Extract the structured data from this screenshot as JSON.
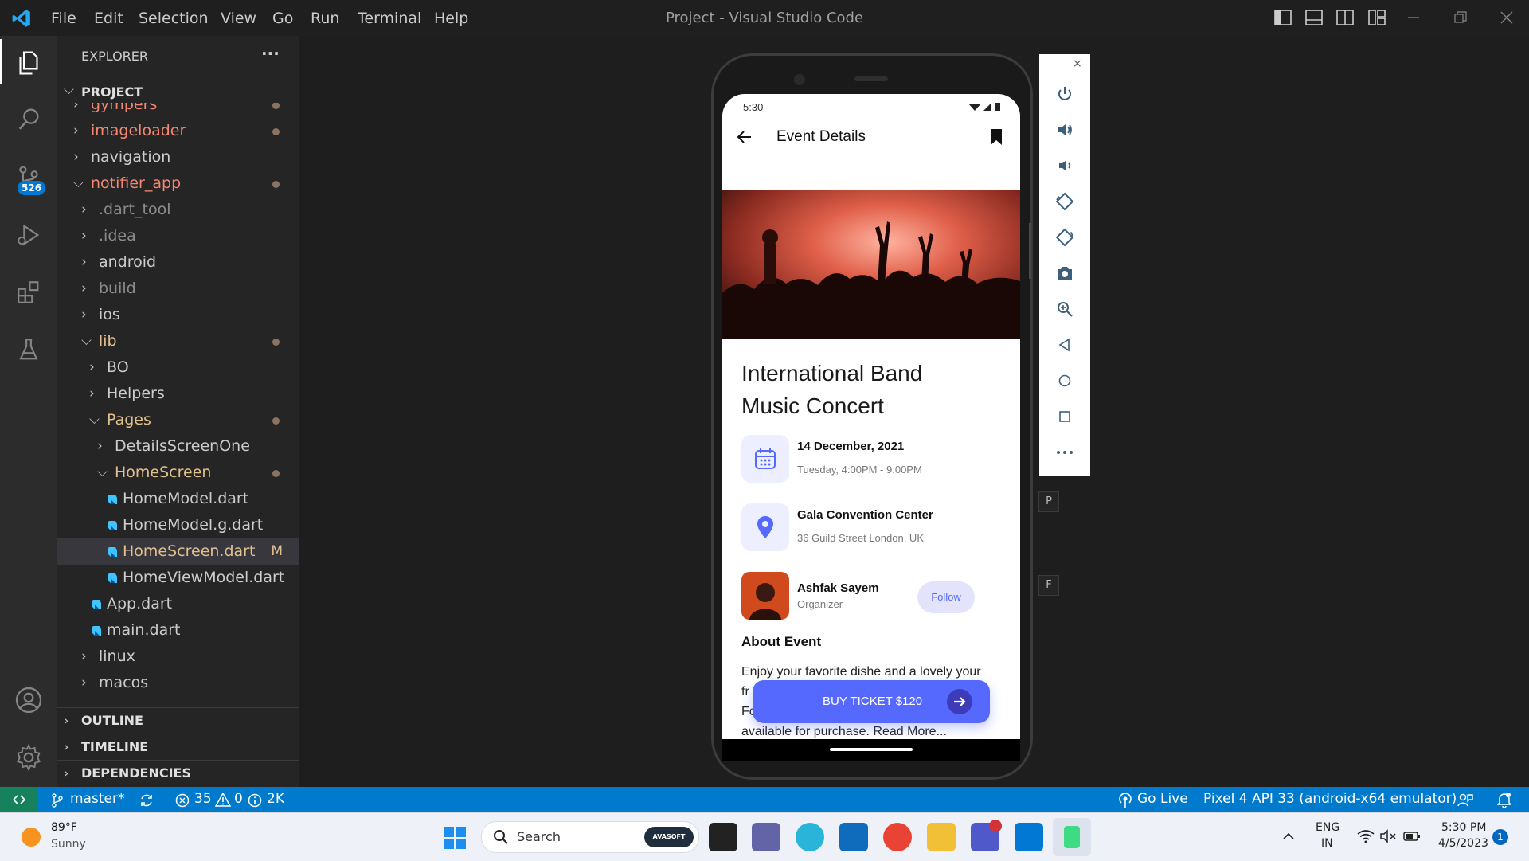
{
  "window": {
    "title": "Project - Visual Studio Code"
  },
  "menu": [
    "File",
    "Edit",
    "Selection",
    "View",
    "Go",
    "Run",
    "Terminal",
    "Help"
  ],
  "activity_bar": {
    "scm_badge": "526"
  },
  "explorer": {
    "title": "EXPLORER",
    "more": "···",
    "root": "PROJECT",
    "items": [
      {
        "label": "gympers",
        "color": "#f48771",
        "dot": true
      },
      {
        "label": "imageloader",
        "color": "#f48771",
        "dot": true
      },
      {
        "label": "navigation",
        "color": "#cccccc",
        "dot": false
      },
      {
        "label": "notifier_app",
        "color": "#f48771",
        "dot": true
      },
      {
        "label": ".dart_tool",
        "color": "#8c8c8c",
        "dot": false
      },
      {
        "label": ".idea",
        "color": "#8c8c8c",
        "dot": false
      },
      {
        "label": "android",
        "color": "#cccccc",
        "dot": false
      },
      {
        "label": "build",
        "color": "#8c8c8c",
        "dot": false
      },
      {
        "label": "ios",
        "color": "#cccccc",
        "dot": false
      },
      {
        "label": "lib",
        "color": "#e2c08d",
        "dot": true
      },
      {
        "label": "BO",
        "color": "#cccccc",
        "dot": false
      },
      {
        "label": "Helpers",
        "color": "#cccccc",
        "dot": false
      },
      {
        "label": "Pages",
        "color": "#e2c08d",
        "dot": true
      },
      {
        "label": "DetailsScreenOne",
        "color": "#cccccc",
        "dot": false
      },
      {
        "label": "HomeScreen",
        "color": "#e2c08d",
        "dot": true
      },
      {
        "label": "HomeModel.dart",
        "color": "#cccccc",
        "dot": false
      },
      {
        "label": "HomeModel.g.dart",
        "color": "#cccccc",
        "dot": false
      },
      {
        "label": "HomeScreen.dart",
        "color": "#e2c08d",
        "dot": false,
        "badge": "M"
      },
      {
        "label": "HomeViewModel.dart",
        "color": "#cccccc",
        "dot": false
      },
      {
        "label": "App.dart",
        "color": "#cccccc",
        "dot": false
      },
      {
        "label": "main.dart",
        "color": "#cccccc",
        "dot": false
      },
      {
        "label": "linux",
        "color": "#cccccc",
        "dot": false
      },
      {
        "label": "macos",
        "color": "#cccccc",
        "dot": false
      }
    ],
    "sections": [
      "OUTLINE",
      "TIMELINE",
      "DEPENDENCIES"
    ]
  },
  "phone": {
    "time": "5:30",
    "header_title": "Event Details",
    "event_title_line1": "International Band",
    "event_title_line2": "Music Concert",
    "date": "14 December, 2021",
    "time_range": "Tuesday, 4:00PM - 9:00PM",
    "venue": "Gala Convention Center",
    "address": "36 Guild Street London, UK",
    "organizer_name": "Ashfak Sayem",
    "organizer_role": "Organizer",
    "follow": "Follow",
    "about_title": "About Event",
    "about_line1": "Enjoy your favorite dishe and a lovely your",
    "about_line2": "fr",
    "about_line3": "Fc",
    "about_line4": "available for purchase. Read More...",
    "buy_button": "BUY TICKET $120",
    "accent": "#5669ff"
  },
  "emulator_toolbar": {
    "minimize": "–",
    "close": "×",
    "key_p": "P",
    "key_f": "F"
  },
  "status_bar": {
    "branch": "master*",
    "errors": "35",
    "warnings": "0",
    "infos": "2K",
    "go_live": "Go Live",
    "device": "Pixel 4 API 33 (android-x64 emulator)"
  },
  "taskbar": {
    "weather_temp": "89°F",
    "weather_desc": "Sunny",
    "search": "Search",
    "search_badge": "AVASOFT",
    "lang1": "ENG",
    "lang2": "IN",
    "clock_time": "5:30 PM",
    "clock_date": "4/5/2023",
    "notif_count": "1"
  }
}
